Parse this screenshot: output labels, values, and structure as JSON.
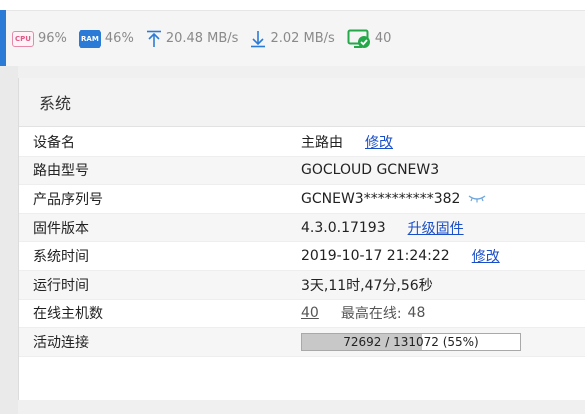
{
  "status": {
    "cpu": {
      "icon": "cpu-icon",
      "icon_text": "CPU",
      "value": "96%"
    },
    "ram": {
      "icon": "ram-icon",
      "icon_text": "RAM",
      "value": "46%"
    },
    "upload": {
      "icon": "upload-arrow-icon",
      "value": "20.48 MB/s"
    },
    "download": {
      "icon": "download-arrow-icon",
      "value": "2.02 MB/s"
    },
    "clients": {
      "icon": "network-check-icon",
      "value": "40"
    }
  },
  "panel": {
    "title": "系统",
    "rows": [
      {
        "label": "设备名",
        "value": "主路由",
        "link": "修改"
      },
      {
        "label": "路由型号",
        "value": "GOCLOUD GCNEW3"
      },
      {
        "label": "产品序列号",
        "value": "GCNEW3**********382"
      },
      {
        "label": "固件版本",
        "value": "4.3.0.17193",
        "link": "升级固件"
      },
      {
        "label": "系统时间",
        "value": "2019-10-17 21:24:22",
        "link": "修改"
      },
      {
        "label": "运行时间",
        "value": "3天,11时,47分,56秒"
      },
      {
        "label": "在线主机数",
        "value": "40",
        "extra_label": "最高在线:",
        "extra_value": "48"
      },
      {
        "label": "活动连接",
        "progress_text": "72692 / 131072 (55%)",
        "progress_fraction": 0.55
      }
    ]
  },
  "colors": {
    "accent_blue": "#2b7bd6",
    "link_blue": "#1a4ec8",
    "cpu_pink": "#e05a86",
    "net_green": "#25a84a"
  }
}
